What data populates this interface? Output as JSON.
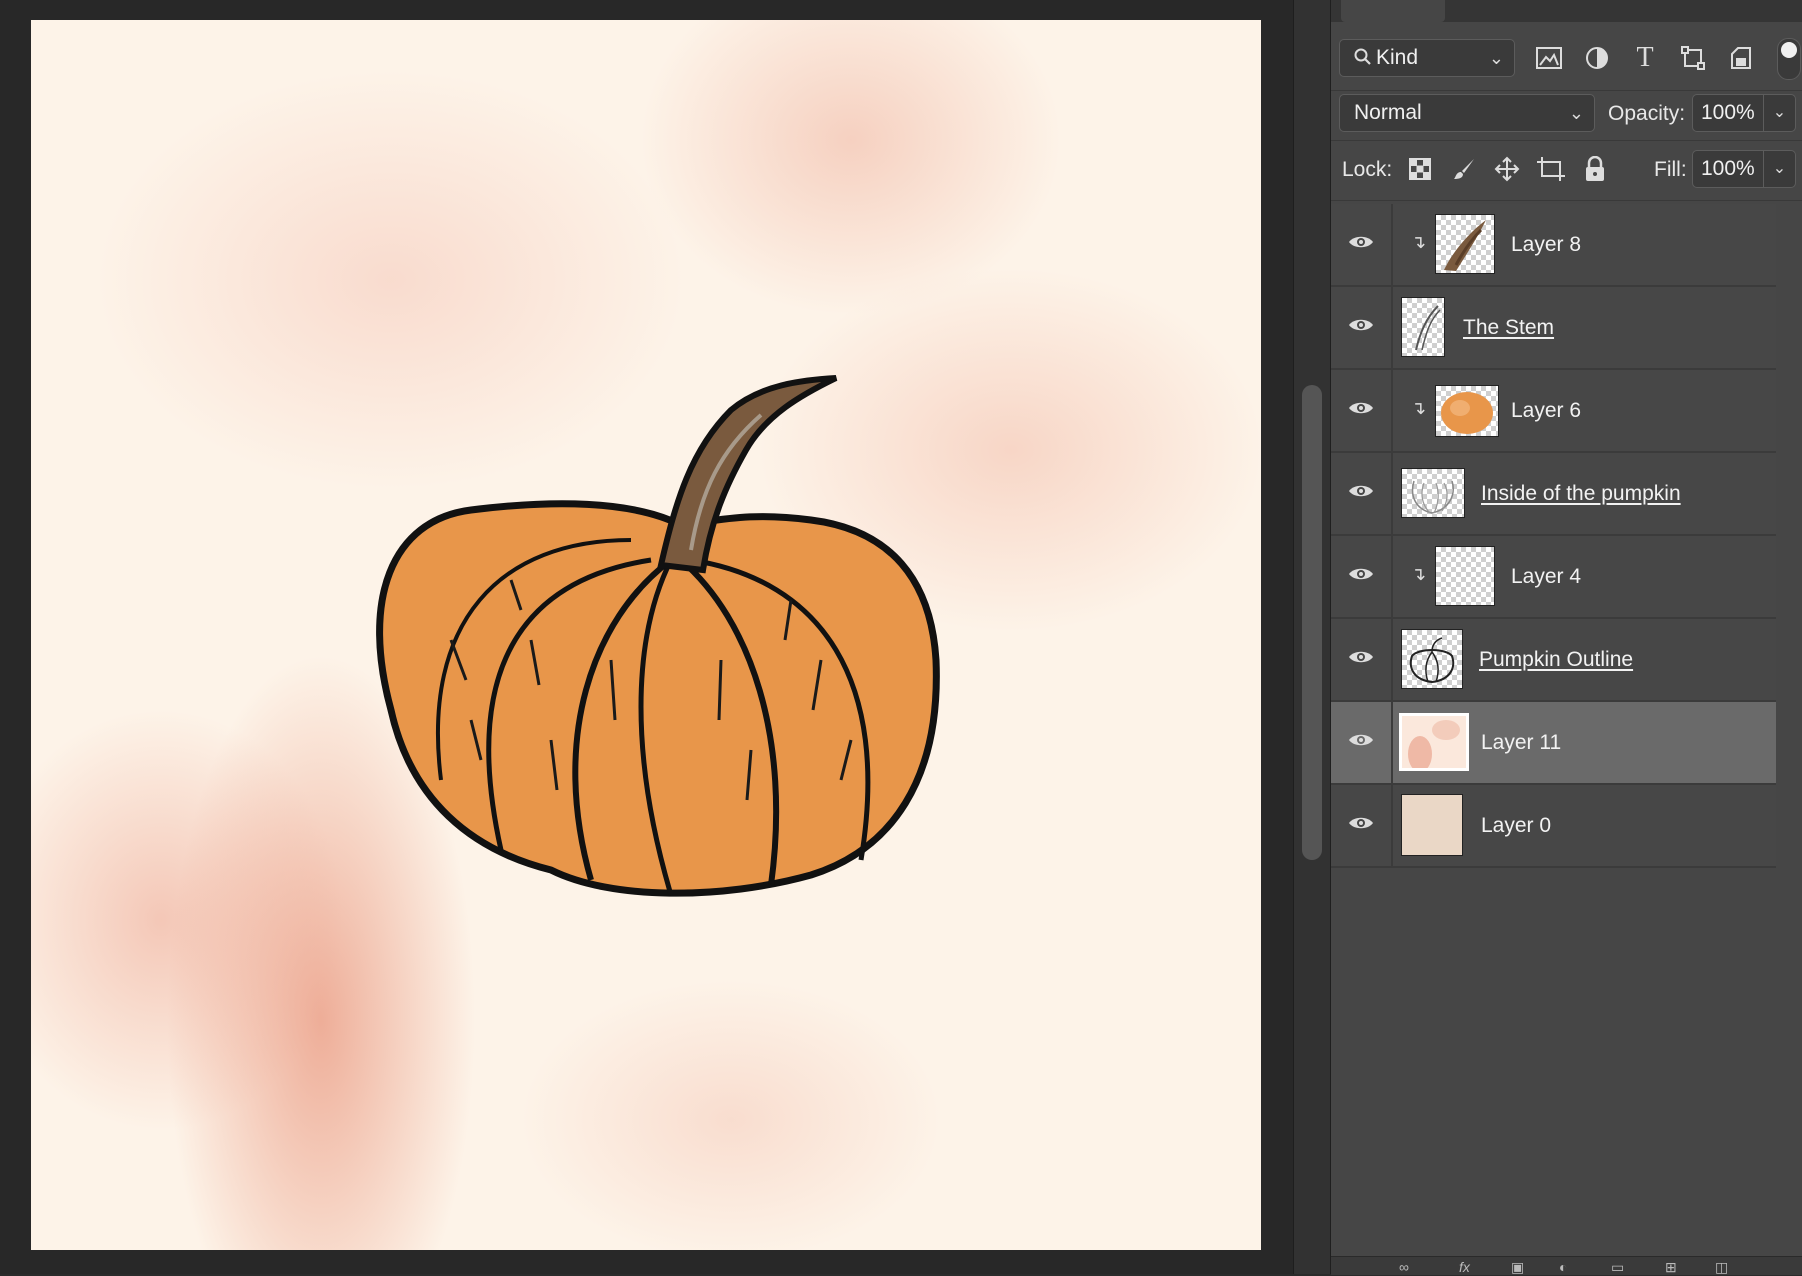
{
  "panel": {
    "filter": {
      "kind_label": "Kind"
    },
    "blend": {
      "mode": "Normal",
      "opacity_label": "Opacity:",
      "opacity_value": "100%"
    },
    "lock": {
      "label": "Lock:",
      "fill_label": "Fill:",
      "fill_value": "100%"
    },
    "filter_icons": [
      "image-filter-icon",
      "adjustment-filter-icon",
      "type-filter-icon",
      "shape-filter-icon",
      "smart-object-filter-icon"
    ],
    "lock_icons": [
      "lock-transparent-pixels-icon",
      "lock-image-pixels-icon",
      "lock-position-icon",
      "lock-artboard-icon",
      "lock-all-icon"
    ]
  },
  "layers": [
    {
      "name": "Layer 8",
      "clipped": true,
      "linked": false,
      "selected": false,
      "thumb": "brown-stroke"
    },
    {
      "name": "The Stem",
      "clipped": false,
      "linked": true,
      "selected": false,
      "thumb": "stem-sketch"
    },
    {
      "name": "Layer 6",
      "clipped": true,
      "linked": false,
      "selected": false,
      "thumb": "orange-blob"
    },
    {
      "name": "Inside of the pumpkin",
      "clipped": false,
      "linked": true,
      "selected": false,
      "thumb": "pumpkin-lines"
    },
    {
      "name": "Layer 4",
      "clipped": true,
      "linked": false,
      "selected": false,
      "thumb": "transparent"
    },
    {
      "name": "Pumpkin Outline",
      "clipped": false,
      "linked": true,
      "selected": false,
      "thumb": "pumpkin-outline"
    },
    {
      "name": "Layer 11",
      "clipped": false,
      "linked": false,
      "selected": true,
      "thumb": "watercolor"
    },
    {
      "name": "Layer 0",
      "clipped": false,
      "linked": false,
      "selected": false,
      "thumb": "beige"
    }
  ],
  "colors": {
    "panel_bg": "#464646",
    "selected_row": "#6a6a6a",
    "pumpkin": "#e8964a",
    "stem": "#7a5a3e",
    "canvas_base": "#fdf3e8",
    "watercolor": "#e9967d"
  }
}
